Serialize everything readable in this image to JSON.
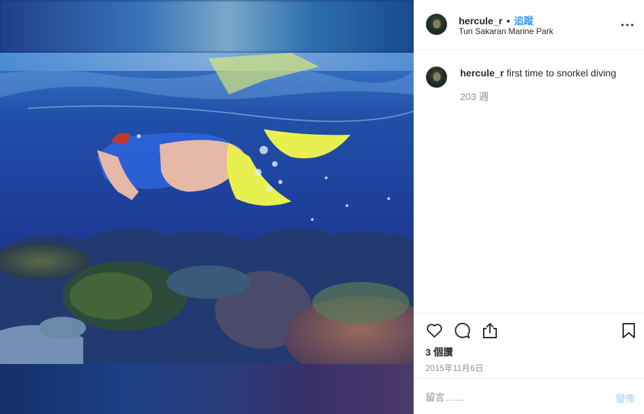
{
  "post": {
    "username": "hercule_r",
    "separator": "•",
    "follow_label": "追蹤",
    "location": "Tun Sakaran Marine Park",
    "more_icon": "more-options-icon"
  },
  "caption": {
    "username": "hercule_r",
    "text": "first time to snorkel diving",
    "age": "203 週"
  },
  "actions": {
    "like_icon": "heart-icon",
    "comment_icon": "comment-bubble-icon",
    "share_icon": "share-icon",
    "save_icon": "bookmark-icon",
    "likes": "3 個讚",
    "date": "2015年11月6日"
  },
  "composer": {
    "placeholder": "留言……",
    "post_label": "發佈"
  },
  "colors": {
    "accent": "#3897f0",
    "post_disabled": "#b2dffc",
    "muted": "#8e8e8e",
    "text": "#262626",
    "border": "#efefef"
  }
}
